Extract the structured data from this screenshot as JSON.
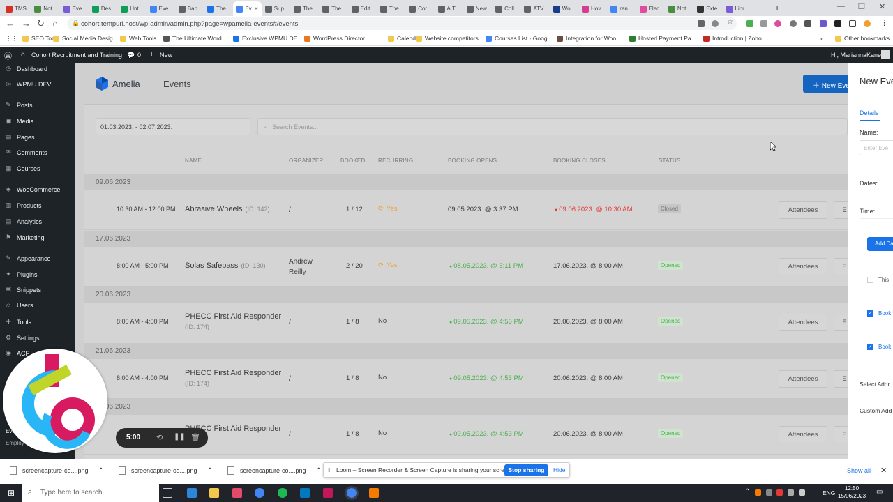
{
  "browser": {
    "tabs": [
      {
        "title": "TMS",
        "color": "#d93025"
      },
      {
        "title": "Not",
        "color": "#4a8d3f"
      },
      {
        "title": "Eve",
        "color": "#7a5cd6"
      },
      {
        "title": "Des",
        "color": "#0f9d58"
      },
      {
        "title": "Unt",
        "color": "#0f9d58"
      },
      {
        "title": "Eve",
        "color": "#4285f4"
      },
      {
        "title": "Ban",
        "color": "#5f6368"
      },
      {
        "title": "The",
        "color": "#1a73e8"
      },
      {
        "title": "Ev",
        "color": "#4285f4"
      },
      {
        "title": "Sup",
        "color": "#5f6368"
      },
      {
        "title": "The",
        "color": "#5f6368"
      },
      {
        "title": "The",
        "color": "#5f6368"
      },
      {
        "title": "Edit",
        "color": "#5f6368"
      },
      {
        "title": "The",
        "color": "#5f6368"
      },
      {
        "title": "Cor",
        "color": "#5f6368"
      },
      {
        "title": "A.T.",
        "color": "#5f6368"
      },
      {
        "title": "New",
        "color": "#5f6368"
      },
      {
        "title": "Coll",
        "color": "#5f6368"
      },
      {
        "title": "ATV",
        "color": "#5f6368"
      },
      {
        "title": "Wo",
        "color": "#1a3a8a"
      },
      {
        "title": "Hov",
        "color": "#d23f8f"
      },
      {
        "title": "ren",
        "color": "#4285f4"
      },
      {
        "title": "Elec",
        "color": "#e04b9e"
      },
      {
        "title": "Not",
        "color": "#4a8d3f"
      },
      {
        "title": "Exte",
        "color": "#333333"
      },
      {
        "title": "Libr",
        "color": "#7a5cd6"
      }
    ],
    "url": "cohort.tempurl.host/wp-admin/admin.php?page=wpamelia-events#/events",
    "bookmarks": [
      "SEO Tools",
      "Social Media Desig...",
      "Web Tools",
      "The Ultimate Word...",
      "Exclusive WPMU DE...",
      "WordPress Director...",
      "Calendar",
      "Website competitors",
      "Courses List - Goog...",
      "Integration for Woo...",
      "Hosted Payment Pa...",
      "Introduction | Zoho..."
    ],
    "other_bookmarks": "Other bookmarks"
  },
  "adminbar": {
    "site": "Cohort Recruitment and Training",
    "comments": "0",
    "new": "New",
    "greeting": "Hi, MariannaKane"
  },
  "sidebar": {
    "items": [
      "Dashboard",
      "WPMU DEV",
      "Posts",
      "Media",
      "Pages",
      "Comments",
      "Courses",
      "WooCommerce",
      "Products",
      "Analytics",
      "Marketing",
      "Appearance",
      "Plugins",
      "Snippets",
      "Users",
      "Tools",
      "Settings",
      "ACF"
    ],
    "sub_partial": [
      "Eve",
      "Employ"
    ]
  },
  "amelia": {
    "brand": "Amelia",
    "page_title": "Events",
    "new_event_button": "New Eve",
    "date_range": "01.03.2023. - 02.07.2023.",
    "search_placeholder": "Search Events...",
    "columns": [
      "NAME",
      "ORGANIZER",
      "BOOKED",
      "RECURRING",
      "BOOKING OPENS",
      "BOOKING CLOSES",
      "STATUS"
    ],
    "groups": [
      {
        "date": "09.06.2023",
        "time": "10:30 AM - 12:00 PM",
        "name": "Abrasive Wheels",
        "id": "(ID: 142)",
        "organizer": "/",
        "booked": "1 / 12",
        "recurring": "Yes",
        "opens": "09.05.2023. @ 3:37 PM",
        "closes": "09.06.2023. @ 10:30 AM",
        "status": "Closed",
        "attendees": "Attendees",
        "edit": "E"
      },
      {
        "date": "17.06.2023",
        "time": "8:00 AM - 5:00 PM",
        "name": "Solas Safepass",
        "id": "(ID: 130)",
        "organizer": "Andrew Reilly",
        "booked": "2 / 20",
        "recurring": "Yes",
        "opens": "08.05.2023. @ 5:11 PM",
        "closes": "17.06.2023. @ 8:00 AM",
        "status": "Opened",
        "attendees": "Attendees",
        "edit": "E"
      },
      {
        "date": "20.06.2023",
        "time": "8:00 AM - 4:00 PM",
        "name": "PHECC First Aid Responder",
        "id": "(ID: 174)",
        "organizer": "/",
        "booked": "1 / 8",
        "recurring": "No",
        "opens": "09.05.2023. @ 4:53 PM",
        "closes": "20.06.2023. @ 8:00 AM",
        "status": "Opened",
        "attendees": "Attendees",
        "edit": "E"
      },
      {
        "date": "21.06.2023",
        "time": "8:00 AM - 4:00 PM",
        "name": "PHECC First Aid Responder",
        "id": "(ID: 174)",
        "organizer": "/",
        "booked": "1 / 8",
        "recurring": "No",
        "opens": "09.05.2023. @ 4:53 PM",
        "closes": "20.06.2023. @ 8:00 AM",
        "status": "Opened",
        "attendees": "Attendees",
        "edit": "E"
      },
      {
        "date": "22.06.2023",
        "time": "8:00 AM",
        "name": "PHECC First Aid Responder",
        "id": "",
        "organizer": "/",
        "booked": "1 / 8",
        "recurring": "No",
        "opens": "09.05.2023. @ 4:53 PM",
        "closes": "20.06.2023. @ 8:00 AM",
        "status": "Opened",
        "attendees": "Attendees",
        "edit": "E"
      }
    ]
  },
  "drawer": {
    "title": "New Eve",
    "tab": "Details",
    "name_label": "Name:",
    "name_placeholder": "Enter Eve",
    "dates_label": "Dates:",
    "time_label": "Time:",
    "add_date_button": "Add Da",
    "this_label": "This",
    "book1": "Book",
    "book2": "Book",
    "select_address": "Select Addr",
    "custom_address": "Custom Add"
  },
  "loom_control": {
    "timer": "5:00"
  },
  "downloads": {
    "files": [
      "screencapture-co....png",
      "screencapture-co....png",
      "screencapture-co....png"
    ],
    "show_all": "Show all"
  },
  "share_bar": {
    "message": "Loom – Screen Recorder & Screen Capture is sharing your screen.",
    "stop": "Stop sharing",
    "hide": "Hide"
  },
  "taskbar": {
    "search_placeholder": "Type here to search",
    "lang": "ENG",
    "time": "12:50",
    "date": "15/06/2023"
  },
  "colors": {
    "accent": "#1a73e8",
    "green": "#4caf50",
    "red": "#e53935",
    "orange": "#f0a030"
  }
}
